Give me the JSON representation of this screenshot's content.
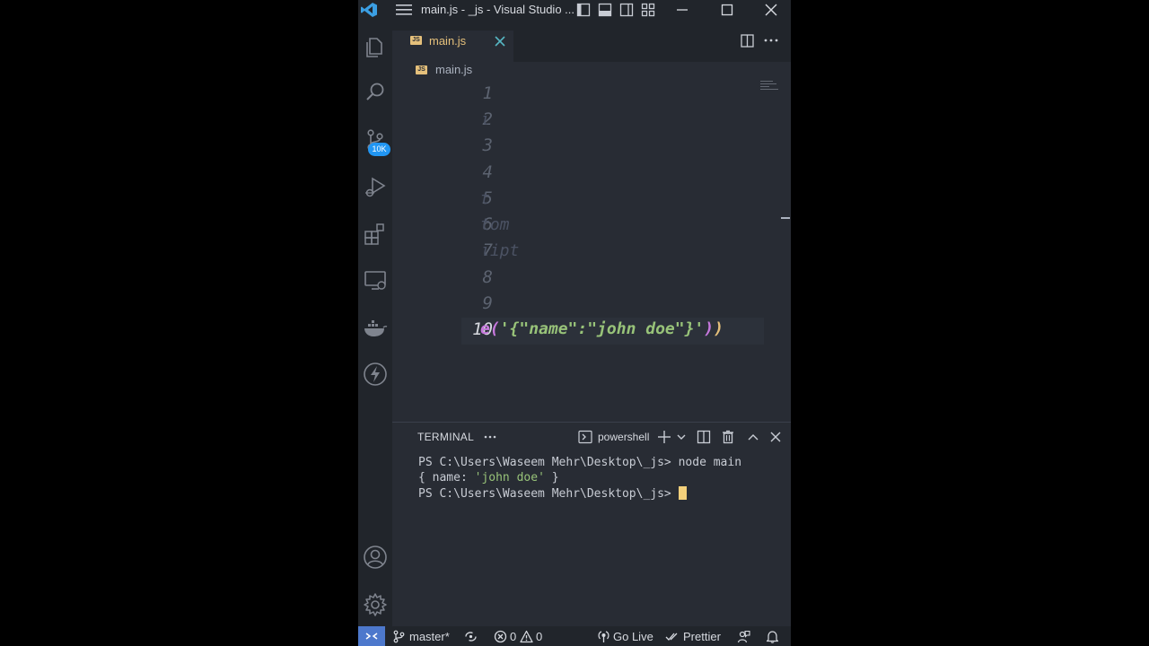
{
  "titlebar": {
    "title": "main.js - _js - Visual Studio ..."
  },
  "activity_bar": {
    "items": [
      "explorer-icon",
      "search-icon",
      "source-control-icon",
      "run-debug-icon",
      "extensions-icon",
      "remote-explorer-icon",
      "docker-icon",
      "thunder-icon"
    ],
    "source_control_badge": "10K",
    "bottom_items": [
      "accounts-icon",
      "settings-icon"
    ]
  },
  "tabs": [
    {
      "label": "main.js",
      "icon": "JS",
      "active": true
    }
  ],
  "breadcrumb": {
    "file": "main.js"
  },
  "editor": {
    "line_numbers": [
      "1",
      "2",
      "3",
      "4",
      "5",
      "6",
      "7",
      "8",
      "9",
      "10"
    ],
    "active_line": "10",
    "fragments": {
      "line2": "ι",
      "line5": "t",
      "line6": "tom",
      "line7": "ιipt"
    },
    "line10": {
      "prefix": "e",
      "open_paren": "(",
      "string": "'{\"name\":\"john doe\"}'",
      "close_paren_inner": ")",
      "close_paren_outer": ")"
    }
  },
  "panel": {
    "title": "TERMINAL",
    "shell": "powershell",
    "lines": {
      "l1": "PS C:\\Users\\Waseem Mehr\\Desktop\\_js> node main",
      "l2_open": "{ name: ",
      "l2_value": "'john doe'",
      "l2_close": " }",
      "l3": "PS C:\\Users\\Waseem Mehr\\Desktop\\_js> "
    }
  },
  "statusbar": {
    "branch": "master*",
    "errors": "0",
    "warnings": "0",
    "go_live": "Go Live",
    "prettier": "Prettier"
  },
  "colors": {
    "accent": "#4d78cc",
    "badge": "#2196f3",
    "js_icon": "#e5c07b",
    "string": "#98c379",
    "cursor": "#f3d07b"
  }
}
